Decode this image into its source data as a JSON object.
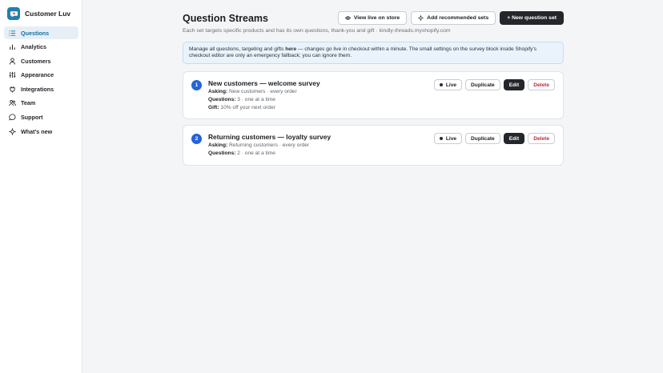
{
  "app": {
    "name": "Customer Luv",
    "accent": "#1f7fb0"
  },
  "sidebar": {
    "items": [
      {
        "label": "Questions",
        "icon": "list-icon",
        "active": true
      },
      {
        "label": "Analytics",
        "icon": "bar-chart-icon",
        "active": false
      },
      {
        "label": "Customers",
        "icon": "person-icon",
        "active": false
      },
      {
        "label": "Appearance",
        "icon": "sliders-icon",
        "active": false
      },
      {
        "label": "Integrations",
        "icon": "plug-icon",
        "active": false
      },
      {
        "label": "Team",
        "icon": "users-icon",
        "active": false
      },
      {
        "label": "Support",
        "icon": "chat-bubble-icon",
        "active": false
      },
      {
        "label": "What's new",
        "icon": "sparkle-icon",
        "active": false
      }
    ]
  },
  "header": {
    "title": "Question Streams",
    "subtitle": "Each set targets specific products and has its own questions, thank-you and gift · kindly-threads.myshopify.com",
    "view_live_label": "View live on store",
    "add_recommended_label": "Add recommended sets",
    "new_set_label": "+ New question set"
  },
  "banner": {
    "text_before": "Manage all questions, targeting and gifts ",
    "text_bold": "here",
    "text_after": " — changes go live in checkout within a minute. The small settings on the survey block inside Shopify's checkout editor are only an emergency fallback; you can ignore them."
  },
  "question_sets": [
    {
      "number": "1",
      "title": "New customers — welcome survey",
      "asking_label": "Asking:",
      "asking_value": "New customers · every order",
      "questions_label": "Questions:",
      "questions_value": "3 · one at a time",
      "gift_label": "Gift:",
      "gift_value": "10% off your next order",
      "status_label": "Live",
      "duplicate_label": "Duplicate",
      "edit_label": "Edit",
      "delete_label": "Delete"
    },
    {
      "number": "2",
      "title": "Returning customers — loyalty survey",
      "asking_label": "Asking:",
      "asking_value": "Returning customers · every order",
      "questions_label": "Questions:",
      "questions_value": "2 · one at a time",
      "status_label": "Live",
      "duplicate_label": "Duplicate",
      "edit_label": "Edit",
      "delete_label": "Delete"
    }
  ]
}
